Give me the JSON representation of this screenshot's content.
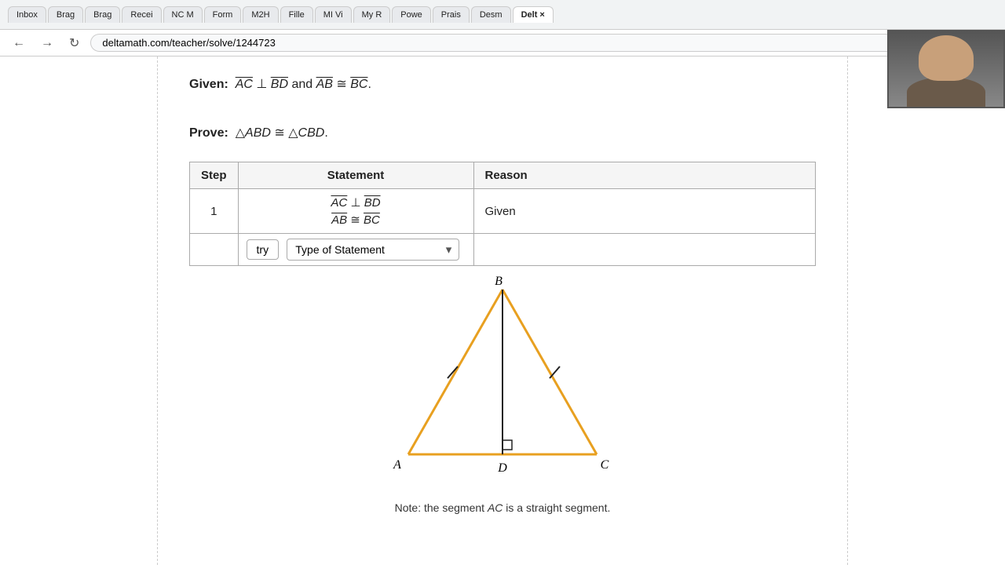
{
  "browser": {
    "tabs": [
      {
        "label": "Inbox",
        "active": false
      },
      {
        "label": "Brag",
        "active": false
      },
      {
        "label": "Brag",
        "active": false
      },
      {
        "label": "Recei",
        "active": false
      },
      {
        "label": "NC M",
        "active": false
      },
      {
        "label": "Form",
        "active": false
      },
      {
        "label": "M2H",
        "active": false
      },
      {
        "label": "Fille",
        "active": false
      },
      {
        "label": "MI Vi",
        "active": false
      },
      {
        "label": "My R",
        "active": false
      },
      {
        "label": "Powe",
        "active": false
      },
      {
        "label": "Prais",
        "active": false
      },
      {
        "label": "Desm",
        "active": false
      },
      {
        "label": "Delt",
        "active": true
      }
    ],
    "address": "deltamath.com/teacher/solve/1244723"
  },
  "proof": {
    "given_label": "Given:",
    "given_content": "AC ⊥ BD and AB ≅ BC.",
    "prove_label": "Prove:",
    "prove_content": "△ABD ≅ △CBD.",
    "table": {
      "col_step": "Step",
      "col_statement": "Statement",
      "col_reason": "Reason",
      "rows": [
        {
          "step": "1",
          "statement_lines": [
            "AC ⊥ BD",
            "AB ≅ BC"
          ],
          "reason": "Given"
        }
      ]
    },
    "try_button": "try",
    "dropdown_placeholder": "Type of Statement",
    "dropdown_options": [
      "Type of Statement"
    ]
  },
  "diagram": {
    "note_prefix": "Note: the segment ",
    "note_segment": "AC",
    "note_suffix": " is a straight segment."
  }
}
